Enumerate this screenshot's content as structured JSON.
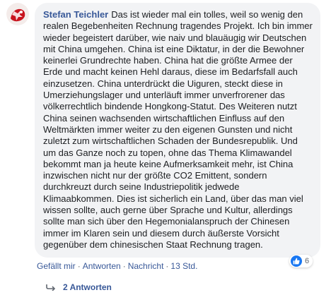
{
  "comment": {
    "author": "Stefan Teichler",
    "text": "Das ist wieder mal ein tolles, weil so wenig den realen Begebenheiten Rechnung tragendes Projekt. Ich bin immer wieder begeistert darüber, wie naiv und blauäugig wir Deutschen mit China umgehen. China ist eine Diktatur, in der die Bewohner keinerlei Grundrechte haben. China hat die größte Armee der Erde und macht keinen Hehl daraus, diese im Bedarfsfall auch einzusetzen. China unterdrückt die Uiguren, steckt diese in Umerziehungslager und unterläuft immer unverfrorener das völkerrechtlich bindende Hongkong-Statut. Des Weiteren nutzt China seinen wachsenden wirtschaftlichen Einfluss auf den Weltmärkten immer weiter zu den eigenen Gunsten und nicht zuletzt zum wirtschaftlichen Schaden der Bundesrepublik. Und um das Ganze noch zu topen, ohne das Thema Klimawandel bekommt man ja heute keine Aufmerksamkeit mehr, ist China inzwischen nicht nur der größte CO2 Emittent, sondern durchkreuzt durch seine Industriepolitik jedwede Klimaabkommen. Dies ist sicherlich ein Land, über das man viel wissen sollte, auch gerne über Sprache und Kultur, allerdings sollte man sich über den Hegemonialanspruch der Chinesen immer im Klaren sein und diesem durch äußerste Vorsicht gegenüber dem chinesischen Staat Rechnung tragen."
  },
  "actions": {
    "like": "Gefällt mir",
    "reply": "Antworten",
    "message": "Nachricht",
    "time": "13 Std.",
    "separator": "·"
  },
  "reactions": {
    "icon": "like-icon",
    "count": "6",
    "color": "#1877f2"
  },
  "replies": {
    "label": "2 Antworten",
    "icon": "reply-arrow-icon"
  },
  "colors": {
    "link": "#385898",
    "bubble": "#f2f3f5",
    "meta": "#606770"
  }
}
